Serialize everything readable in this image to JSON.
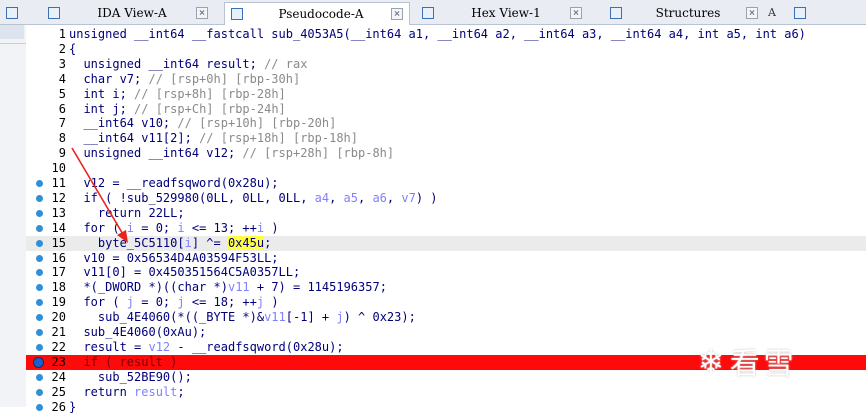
{
  "tabs": [
    {
      "label": "IDA View-A",
      "icon": "graph-view-icon",
      "active": false,
      "num": ""
    },
    {
      "label": "Pseudocode-A",
      "icon": "pseudocode-icon",
      "active": true,
      "num": ""
    },
    {
      "label": "Hex View-1",
      "icon": "hex-view-icon",
      "active": false,
      "num": ""
    },
    {
      "label": "Structures",
      "icon": "structures-icon",
      "active": false,
      "num": "A"
    },
    {
      "label": "",
      "icon": "enums-icon",
      "active": false,
      "num": ""
    }
  ],
  "lines": [
    {
      "n": "1",
      "dot": false,
      "html": "<span class=\"kw\">unsigned __int64 __fastcall sub_4053A5(__int64 a1, __int64 a2, __int64 a3, __int64 a4, int a5, int a6)</span>"
    },
    {
      "n": "2",
      "dot": false,
      "html": "{"
    },
    {
      "n": "3",
      "dot": false,
      "html": "  <span class=\"kw\">unsigned __int64 result;</span> <span class=\"cmt\">// rax</span>"
    },
    {
      "n": "4",
      "dot": false,
      "html": "  <span class=\"kw\">char v7;</span> <span class=\"cmt\">// [rsp+0h] [rbp-30h]</span>"
    },
    {
      "n": "5",
      "dot": false,
      "html": "  <span class=\"kw\">int i;</span> <span class=\"cmt\">// [rsp+8h] [rbp-28h]</span>"
    },
    {
      "n": "6",
      "dot": false,
      "html": "  <span class=\"kw\">int j;</span> <span class=\"cmt\">// [rsp+Ch] [rbp-24h]</span>"
    },
    {
      "n": "7",
      "dot": false,
      "html": "  <span class=\"kw\">__int64 v10;</span> <span class=\"cmt\">// [rsp+10h] [rbp-20h]</span>"
    },
    {
      "n": "8",
      "dot": false,
      "html": "  <span class=\"kw\">__int64 v11[2];</span> <span class=\"cmt\">// [rsp+18h] [rbp-18h]</span>"
    },
    {
      "n": "9",
      "dot": false,
      "html": "  <span class=\"kw\">unsigned __int64 v12;</span> <span class=\"cmt\">// [rsp+28h] [rbp-8h]</span>"
    },
    {
      "n": "10",
      "dot": false,
      "html": ""
    },
    {
      "n": "11",
      "dot": true,
      "html": "  v12 = __readfsqword(0x28u);"
    },
    {
      "n": "12",
      "dot": true,
      "html": "  if ( !sub_529980(0LL, 0LL, 0LL, <span class=\"var\">a4</span>, <span class=\"var\">a5</span>, <span class=\"var\">a6</span>, <span class=\"var\">v7</span>) )"
    },
    {
      "n": "13",
      "dot": true,
      "html": "    return 22LL;"
    },
    {
      "n": "14",
      "dot": true,
      "html": "  for ( <span class=\"var\">i</span> = 0; <span class=\"var\">i</span> &lt;= 13; ++<span class=\"var\">i</span> )"
    },
    {
      "n": "15",
      "dot": true,
      "hl": true,
      "html": "    byte_5C5110[<span class=\"var\">i</span>] ^= <span class=\"yel\">0x45u</span>;"
    },
    {
      "n": "16",
      "dot": true,
      "html": "  v10 = 0x56534D4A03594F53LL;"
    },
    {
      "n": "17",
      "dot": true,
      "html": "  v11[0] = 0x450351564C5A0357LL;"
    },
    {
      "n": "18",
      "dot": true,
      "html": "  *(_DWORD *)((<span class=\"kw\">char</span> *)<span class=\"var\">v11</span> + 7) = 1145196357;"
    },
    {
      "n": "19",
      "dot": true,
      "html": "  for ( <span class=\"var\">j</span> = 0; <span class=\"var\">j</span> &lt;= 18; ++<span class=\"var\">j</span> )"
    },
    {
      "n": "20",
      "dot": true,
      "html": "    sub_4E4060(*((_BYTE *)&amp;<span class=\"var\">v11</span>[-1] + <span class=\"var\">j</span>) ^ 0x23);"
    },
    {
      "n": "21",
      "dot": true,
      "html": "  sub_4E4060(0xAu);"
    },
    {
      "n": "22",
      "dot": true,
      "html": "  result = <span class=\"var\">v12</span> - __readfsqword(0x28u);"
    },
    {
      "n": "23",
      "dot": true,
      "bp": true,
      "html": "  if ( result )"
    },
    {
      "n": "24",
      "dot": true,
      "html": "    sub_52BE90();"
    },
    {
      "n": "25",
      "dot": true,
      "html": "  return <span class=\"var\">result</span>;"
    },
    {
      "n": "26",
      "dot": true,
      "html": "}"
    }
  ],
  "watermark": {
    "text": "看雪",
    "icon": "snowflake-icon"
  }
}
